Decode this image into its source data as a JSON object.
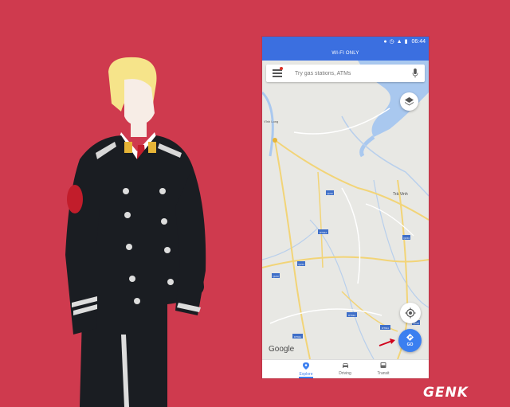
{
  "status_bar": {
    "time": "06:44"
  },
  "banner": {
    "text": "WI-FI ONLY"
  },
  "search": {
    "placeholder": "Try gas stations, ATMs"
  },
  "map": {
    "place_labels": {
      "tra_vinh": "Trà Vinh",
      "vinh_long": "Vĩnh Long"
    },
    "road_shields": [
      "QL53",
      "QL54",
      "DT912",
      "QL54",
      "QL53",
      "DT912",
      "DT911",
      "DT911",
      "QL54"
    ],
    "attribution": "Google"
  },
  "go_button": {
    "label": "GO"
  },
  "bottom_nav": {
    "items": [
      {
        "label": "Explore",
        "icon": "explore-pin-icon",
        "active": true
      },
      {
        "label": "Driving",
        "icon": "car-icon",
        "active": false
      },
      {
        "label": "Transit",
        "icon": "bus-icon",
        "active": false
      }
    ]
  },
  "watermark": {
    "text": "GENK"
  },
  "colors": {
    "background": "#cf3a4e",
    "app_bar": "#3b6fe0",
    "accent": "#3b7ff0",
    "arrow": "#d0021b"
  }
}
